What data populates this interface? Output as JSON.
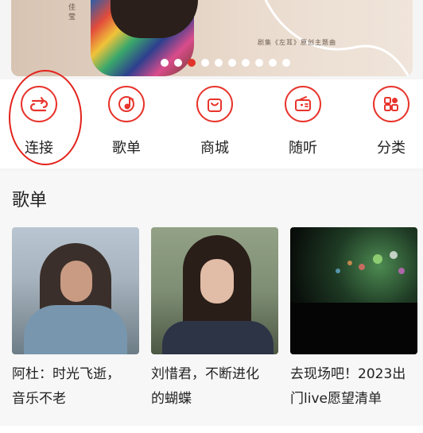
{
  "banner": {
    "side_text": "佳 莹",
    "caption": "剧集《左耳》原创主题曲",
    "indicator": {
      "total": 10,
      "active_index": 2
    }
  },
  "nav": {
    "items": [
      {
        "label": "连接",
        "icon": "link-icon"
      },
      {
        "label": "歌单",
        "icon": "music-note-icon"
      },
      {
        "label": "商城",
        "icon": "shopping-bag-icon"
      },
      {
        "label": "随听",
        "icon": "radio-icon"
      },
      {
        "label": "分类",
        "icon": "category-icon"
      }
    ],
    "highlight_color": "#e3221c",
    "accent_color": "#e7342c"
  },
  "playlists": {
    "title": "歌单",
    "cards": [
      {
        "title_line1": "阿杜：时光飞逝，",
        "title_line2": "音乐不老"
      },
      {
        "title_line1": "刘惜君，不断进化",
        "title_line2": "的蝴蝶"
      },
      {
        "title_line1": "去现场吧！2023出",
        "title_line2": "门live愿望清单"
      }
    ]
  }
}
